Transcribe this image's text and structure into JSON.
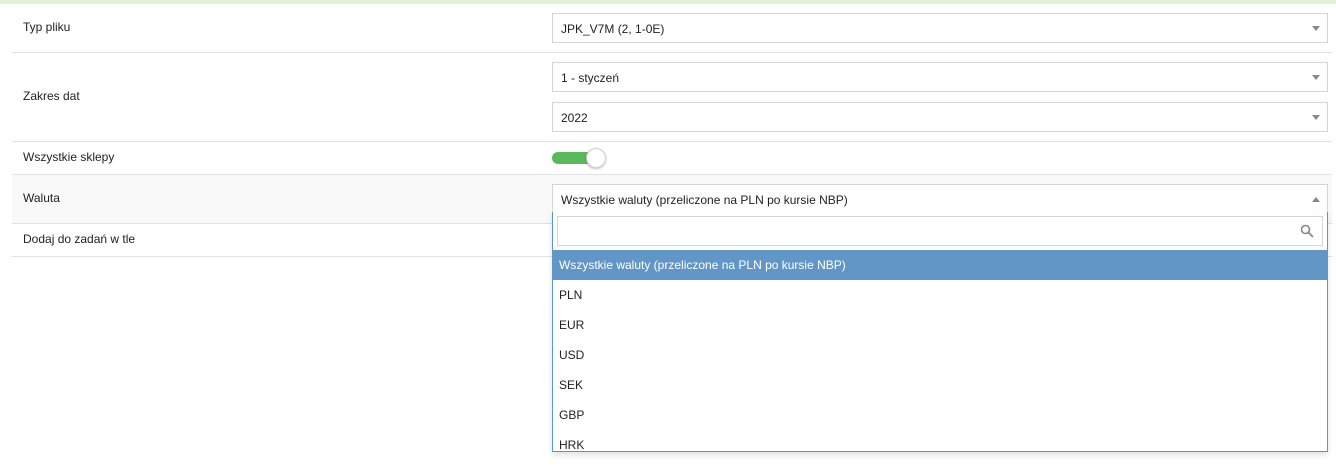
{
  "form": {
    "file_type": {
      "label": "Typ pliku",
      "value": "JPK_V7M (2, 1-0E)"
    },
    "date_range": {
      "label": "Zakres dat",
      "month_value": "1 - styczeń",
      "year_value": "2022"
    },
    "all_shops": {
      "label": "Wszystkie sklepy",
      "enabled": true,
      "color": "#5cb85c"
    },
    "currency": {
      "label": "Waluta",
      "value": "Wszystkie waluty (przeliczone na PLN po kursie NBP)",
      "dropdown_open": true,
      "search_value": "",
      "options": [
        "Wszystkie waluty (przeliczone na PLN po kursie NBP)",
        "PLN",
        "EUR",
        "USD",
        "SEK",
        "GBP",
        "HRK"
      ],
      "highlighted_color": "#6296c6"
    },
    "background_task": {
      "label": "Dodaj do zadań w tle"
    }
  }
}
